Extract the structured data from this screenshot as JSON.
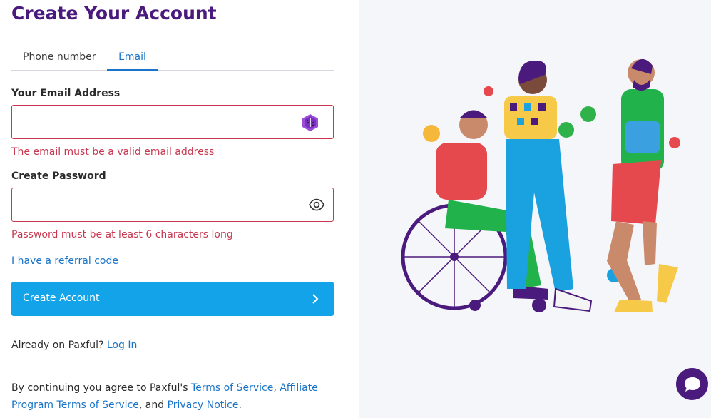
{
  "page": {
    "title": "Create Your Account"
  },
  "tabs": [
    {
      "label": "Phone number",
      "active": false
    },
    {
      "label": "Email",
      "active": true
    }
  ],
  "email": {
    "label": "Your Email Address",
    "value": "",
    "placeholder": "",
    "error": "The email must be a valid email address",
    "icon": "keyboard-icon"
  },
  "password": {
    "label": "Create Password",
    "value": "",
    "placeholder": "",
    "error": "Password must be at least 6 characters long",
    "icon": "eye-icon"
  },
  "referral_link": "I have a referral code",
  "create_button": {
    "label": "Create Account",
    "icon": "chevron-right-icon",
    "color": "#12a3e8"
  },
  "login": {
    "prefix": "Already on Paxful?",
    "link": "Log In"
  },
  "terms": {
    "prefix": "By continuing you agree to Paxful's",
    "tos": "Terms of Service",
    "comma": ",",
    "affiliate": "Affiliate Program Terms of Service",
    "and": ", and",
    "privacy": "Privacy Notice",
    "end": "."
  },
  "colors": {
    "brand": "#4b1a7d",
    "link": "#1a74c9",
    "error": "#c8374f",
    "panel": "#f5f6fa"
  },
  "chat": {
    "icon": "chat-bubble-icon"
  }
}
